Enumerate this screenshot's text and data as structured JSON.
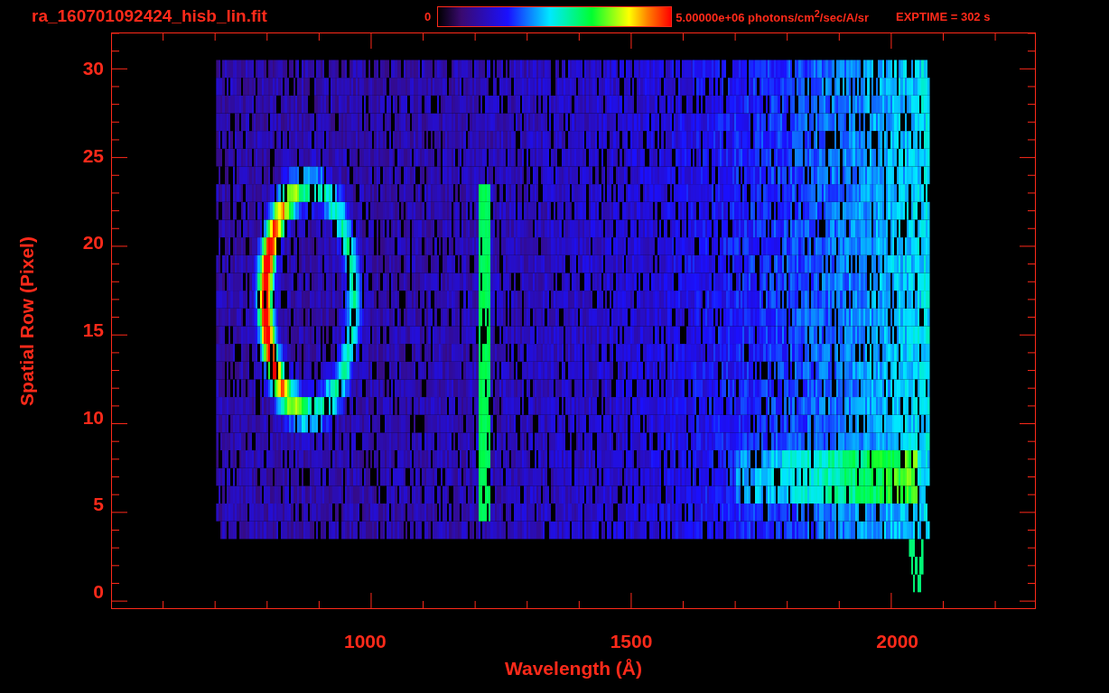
{
  "header": {
    "filename": "ra_160701092424_hisb_lin.fit",
    "colorbar": {
      "min_label": "0",
      "max_label": "5.00000e+06 photons/cm$^{2}$/sec/A/sr"
    },
    "exposure": "EXPTIME = 302 s"
  },
  "plot": {
    "xlabel": "Wavelength (Å)",
    "ylabel": "Spatial Row (Pixel)",
    "x_tick_labels": [
      "1000",
      "1500",
      "2000"
    ],
    "y_tick_labels": [
      "30",
      "25",
      "20",
      "15",
      "10",
      "5",
      "0"
    ]
  }
}
